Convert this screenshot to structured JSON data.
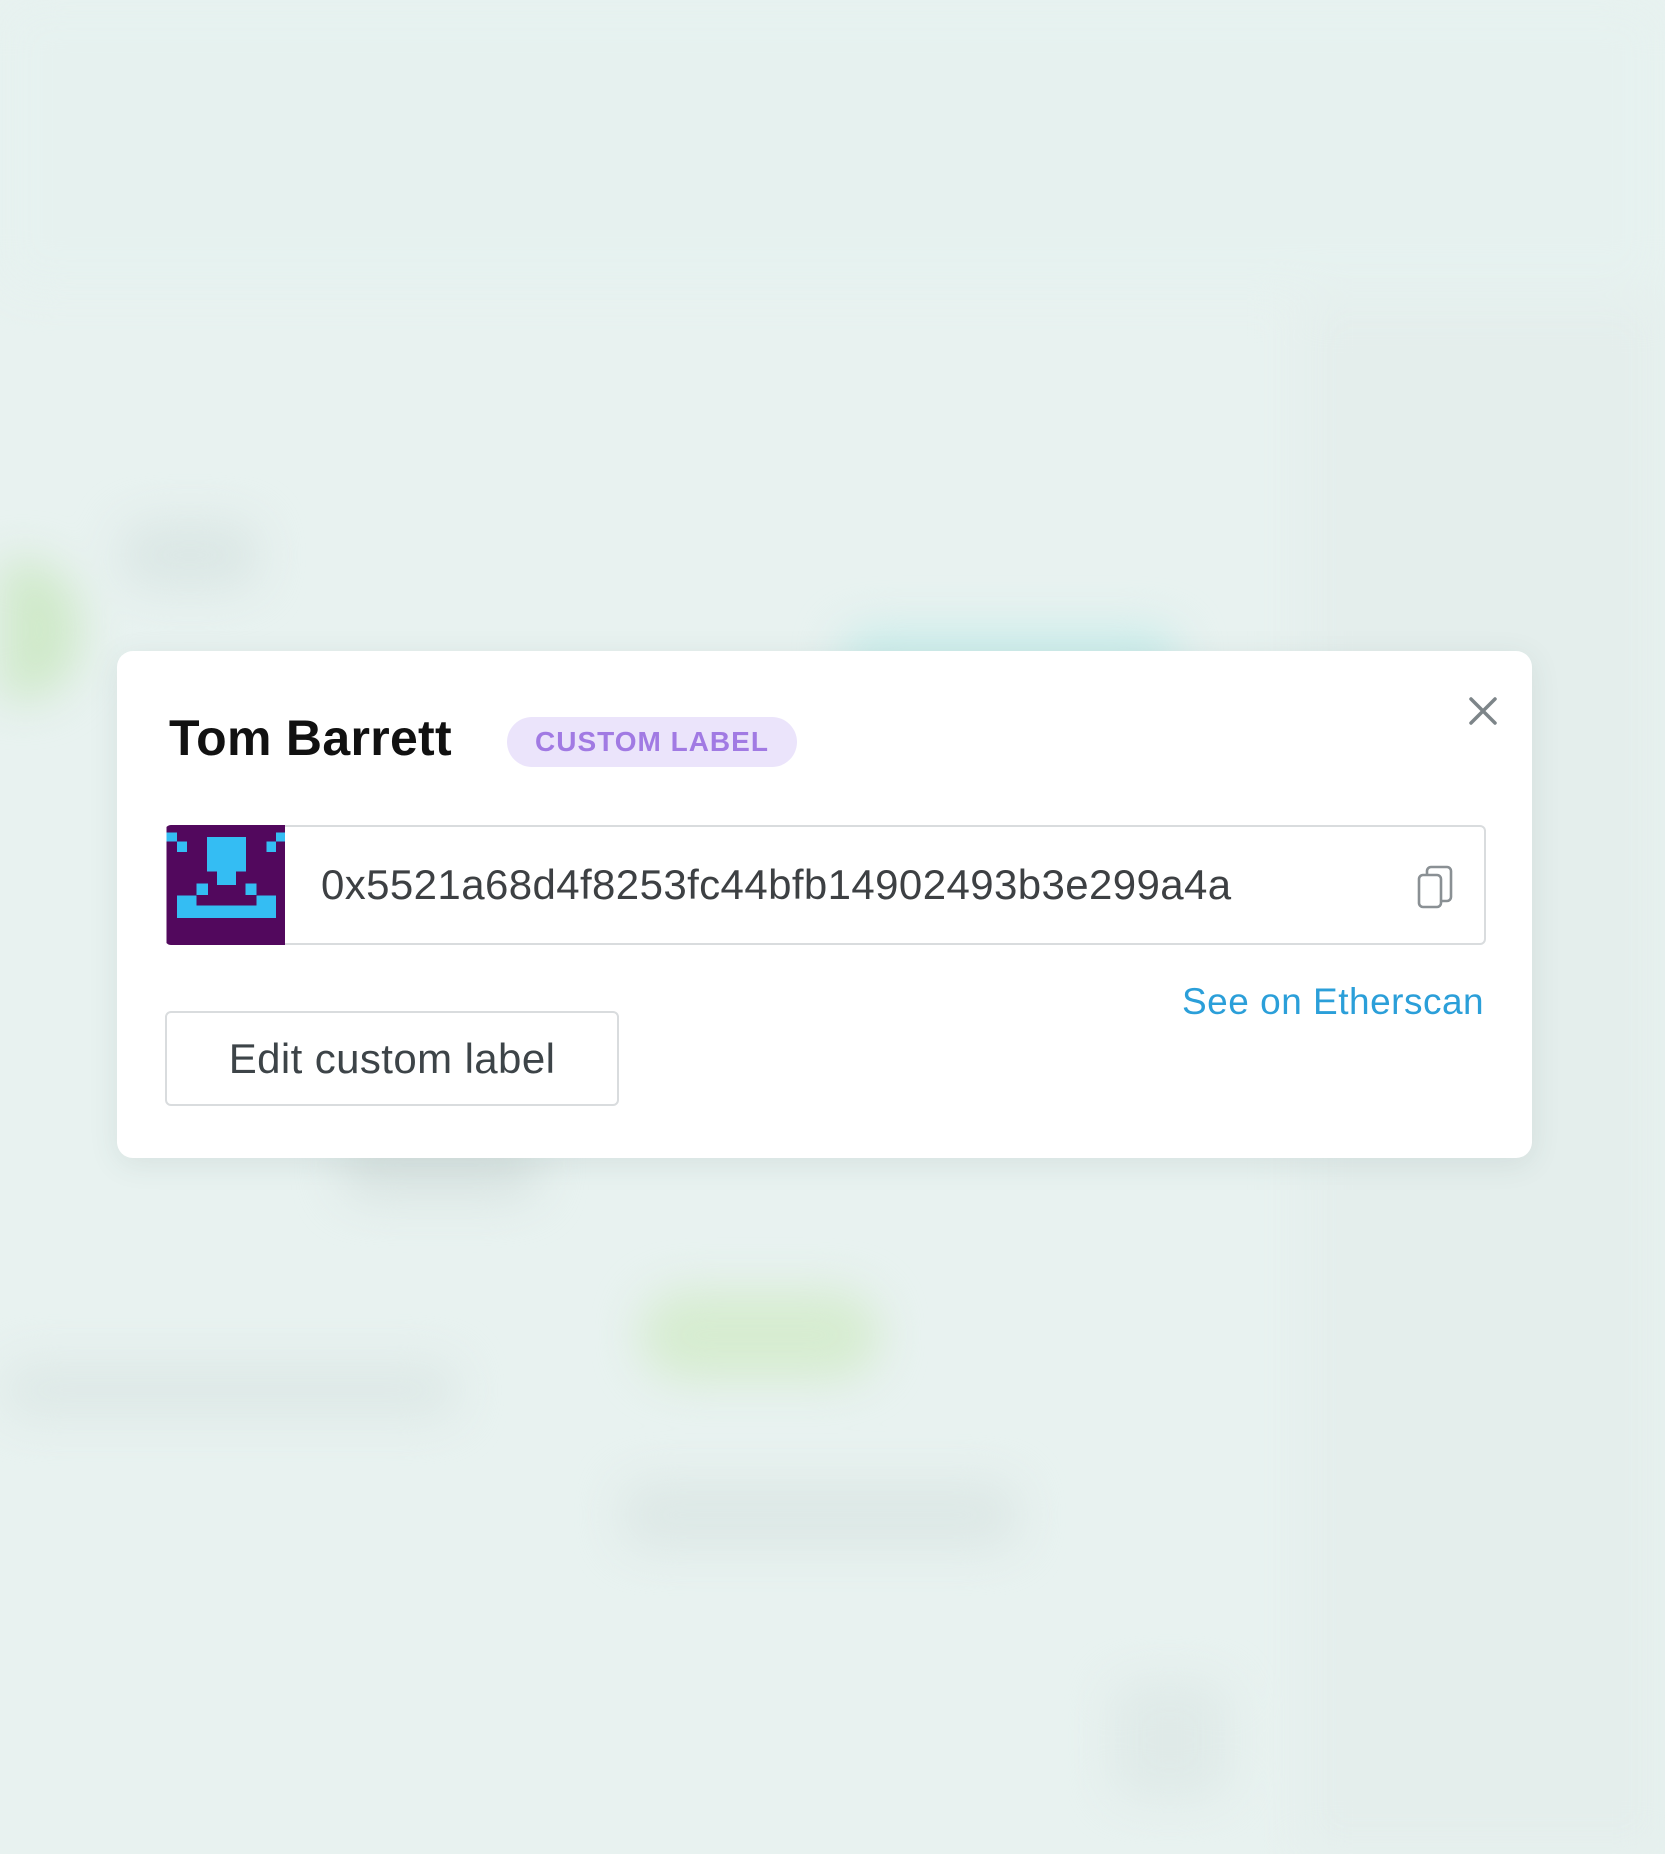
{
  "contact": {
    "name": "Tom Barrett",
    "badge": "CUSTOM LABEL",
    "avatar_colors": {
      "background": "#52085d",
      "foreground": "#34bdf3"
    },
    "address": "0x5521a68d4f8253fc44bfb14902493b3e299a4a"
  },
  "actions": {
    "etherscan_label": "See on Etherscan",
    "edit_label": "Edit custom label"
  },
  "icons": {
    "close": "close-icon",
    "copy": "copy-icon"
  },
  "colors": {
    "link": "#2b9fd9",
    "badge_text": "#a17ae3",
    "badge_bg": "#ebe4fb"
  }
}
